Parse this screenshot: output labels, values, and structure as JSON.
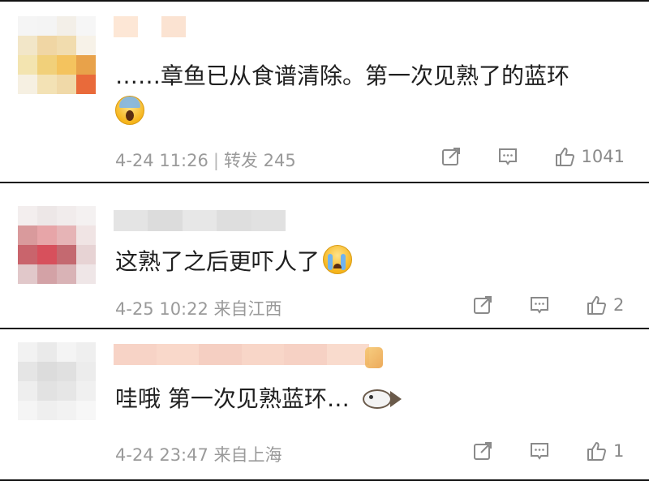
{
  "comments": [
    {
      "text": "……章鱼已从食谱清除。第一次见熟了的蓝环",
      "emoji": "scream-emoji",
      "date": "4-24 11:26",
      "source": "转发 245",
      "likes": "1041",
      "avatar_colors": [
        "#f5f5f5",
        "#f4f4f4",
        "#f3efe8",
        "#f6f6f6",
        "#f2e6c8",
        "#f0d6a4",
        "#f1dcae",
        "#f7f2e8",
        "#f3e4b0",
        "#f1d07a",
        "#f4c35e",
        "#e8a24a",
        "#f6f0e2",
        "#f3e2b5",
        "#f0d9a8",
        "#e96a3a"
      ],
      "username_colors": [
        "#fde7d6",
        "#ffffff",
        "#fbe3d2",
        "#ffffff"
      ]
    },
    {
      "text": "这熟了之后更吓人了",
      "emoji": "crying-emoji",
      "date": "4-25 10:22",
      "source": "来自江西",
      "likes": "2",
      "avatar_colors": [
        "#f3eeee",
        "#ede7e7",
        "#f1ecec",
        "#f4f1f1",
        "#d99a9c",
        "#e7a5a8",
        "#e6b4b6",
        "#f0e4e4",
        "#c9646c",
        "#d7505c",
        "#c46970",
        "#e7d3d4",
        "#e1c8ca",
        "#d3a2a6",
        "#d9b3b6",
        "#efe6e7"
      ],
      "username_colors": [
        "#e4e4e4",
        "#dcdcdc",
        "#e7e7e7",
        "#dedede",
        "#e1e1e1"
      ]
    },
    {
      "text": "哇哦 第一次见熟蓝环…",
      "emoji": "fish-emoji",
      "date": "4-24 23:47",
      "source": "来自上海",
      "likes": "1",
      "avatar_colors": [
        "#f2f2f2",
        "#eaeaea",
        "#f4f4f4",
        "#efefef",
        "#e5e5e5",
        "#dcdcdc",
        "#e0e0e0",
        "#ececec",
        "#eeeeee",
        "#e2e2e2",
        "#e6e6e6",
        "#f0f0f0",
        "#f5f5f5",
        "#efefef",
        "#f2f2f2",
        "#f7f7f7"
      ],
      "username_colors": [
        "#f7d3c6",
        "#f9d8ca",
        "#f5cfc2",
        "#f8d6c8",
        "#f6d1c4",
        "#f9dbcd"
      ]
    }
  ],
  "icons": {
    "share": "share-icon",
    "comment": "comment-icon",
    "like": "thumbs-up-icon"
  },
  "colors": {
    "text": "#1f1f1f",
    "meta": "#9a9a9a",
    "divider": "#111111",
    "icon": "#8a8a8a"
  }
}
